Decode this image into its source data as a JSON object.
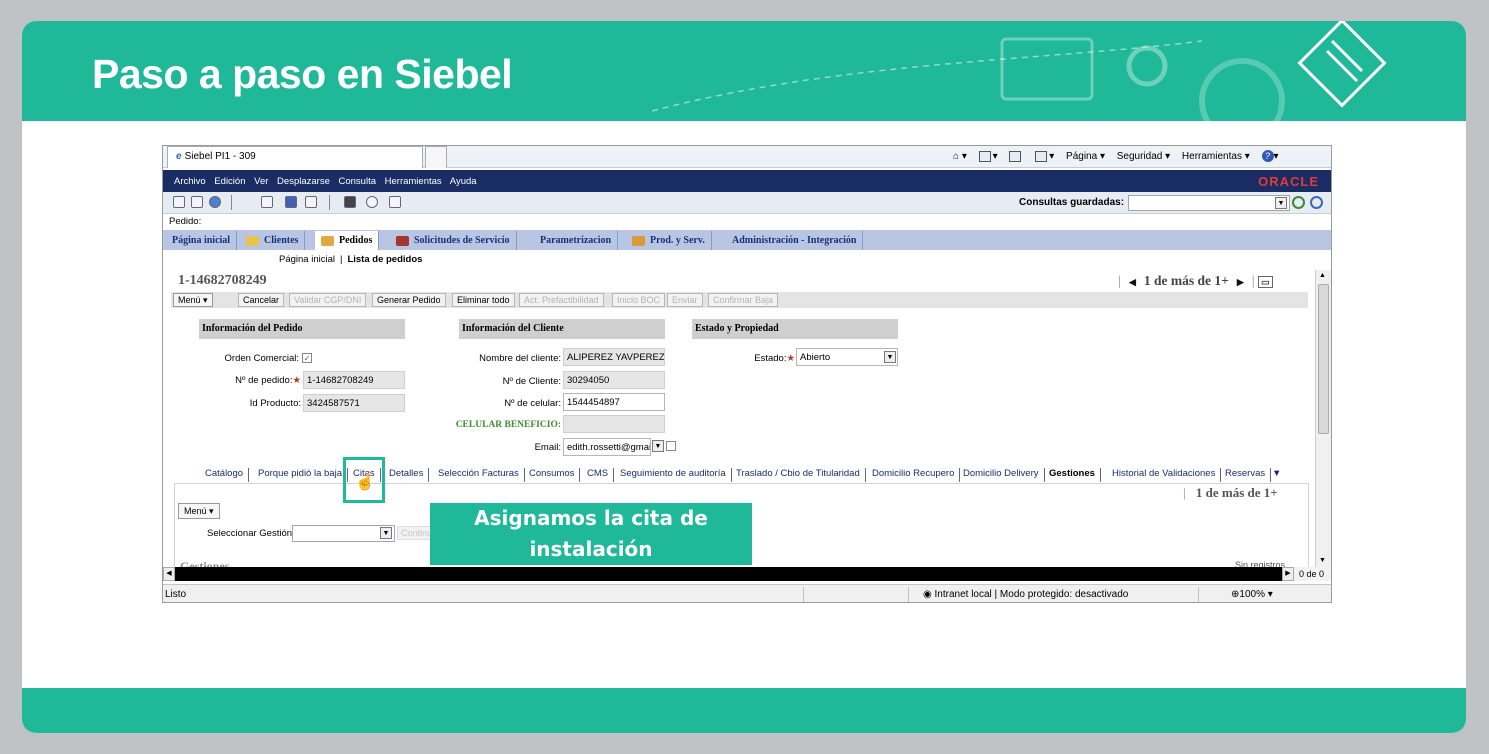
{
  "slide": {
    "title": "Paso a paso en Siebel"
  },
  "browser": {
    "tab_title": "Siebel PI1 - 309",
    "tools": [
      "Página ▾",
      "Seguridad ▾",
      "Herramientas ▾"
    ]
  },
  "app_menu": [
    "Archivo",
    "Edición",
    "Ver",
    "Desplazarse",
    "Consulta",
    "Herramientas",
    "Ayuda"
  ],
  "brand": "ORACLE",
  "toolbar": {
    "saved_queries_label": "Consultas guardadas:"
  },
  "screen_label": "Pedido:",
  "main_tabs": [
    "Página inicial",
    "Clientes",
    "Pedidos",
    "Solicitudes de Servicio",
    "Parametrizacion",
    "Prod. y Serv.",
    "Administración - Integración"
  ],
  "breadcrumb": {
    "home": "Página inicial",
    "current": "Lista de pedidos"
  },
  "record": {
    "id": "1-14682708249",
    "pager": "1 de más de 1+"
  },
  "actions": {
    "menu": "Menú ▾",
    "buttons": [
      "Cancelar",
      "Validar CGP/DNI",
      "Generar Pedido",
      "Eliminar todo",
      "Act. Prefactibilidad",
      "Inicio BOC",
      "Enviar",
      "Confirmar Baja"
    ]
  },
  "pedido": {
    "header": "Información del Pedido",
    "orden_comercial_label": "Orden Comercial:",
    "numero_label": "Nº de pedido:",
    "numero_value": "1-14682708249",
    "producto_label": "Id Producto:",
    "producto_value": "3424587571"
  },
  "cliente": {
    "header": "Información del Cliente",
    "nombre_label": "Nombre del cliente:",
    "nombre_value": "ALIPEREZ YAVPEREZ",
    "num_cliente_label": "Nº de Cliente:",
    "num_cliente_value": "30294050",
    "celular_label": "Nº de celular:",
    "celular_value": "1544454897",
    "beneficio_label": "CELULAR BENEFICIO:",
    "email_label": "Email:",
    "email_value": "edith.rossetti@gmai"
  },
  "estado": {
    "header": "Estado y Propiedad",
    "estado_label": "Estado:",
    "estado_value": "Abierto"
  },
  "sub_tabs": [
    "Catálogo",
    "Porque pidió la baja",
    "Citas",
    "Detalles",
    "Selección Facturas",
    "Consumos",
    "CMS",
    "Seguimiento de auditoría",
    "Traslado / Cbio de Titularidad",
    "Domicilio Recupero",
    "Domicilio Delivery",
    "Gestiones",
    "Historial de Validaciones",
    "Reservas"
  ],
  "sub_panel": {
    "pager": "1 de más de 1+",
    "menu": "Menú ▾",
    "select_label": "Seleccionar Gestión:",
    "continue_label": "Continuar",
    "gestiones_label": "Gestiones",
    "sin_registros": "Sin registros",
    "count": "0 de 0"
  },
  "status": {
    "text": "Listo",
    "zone": "Intranet local | Modo protegido: desactivado",
    "zoom": "100%"
  },
  "callout": {
    "text": "Asignamos la cita de instalación"
  },
  "colors": {
    "banner": "#1fb898",
    "navy": "#1a2c64",
    "tabs": "#b8c6e3"
  }
}
